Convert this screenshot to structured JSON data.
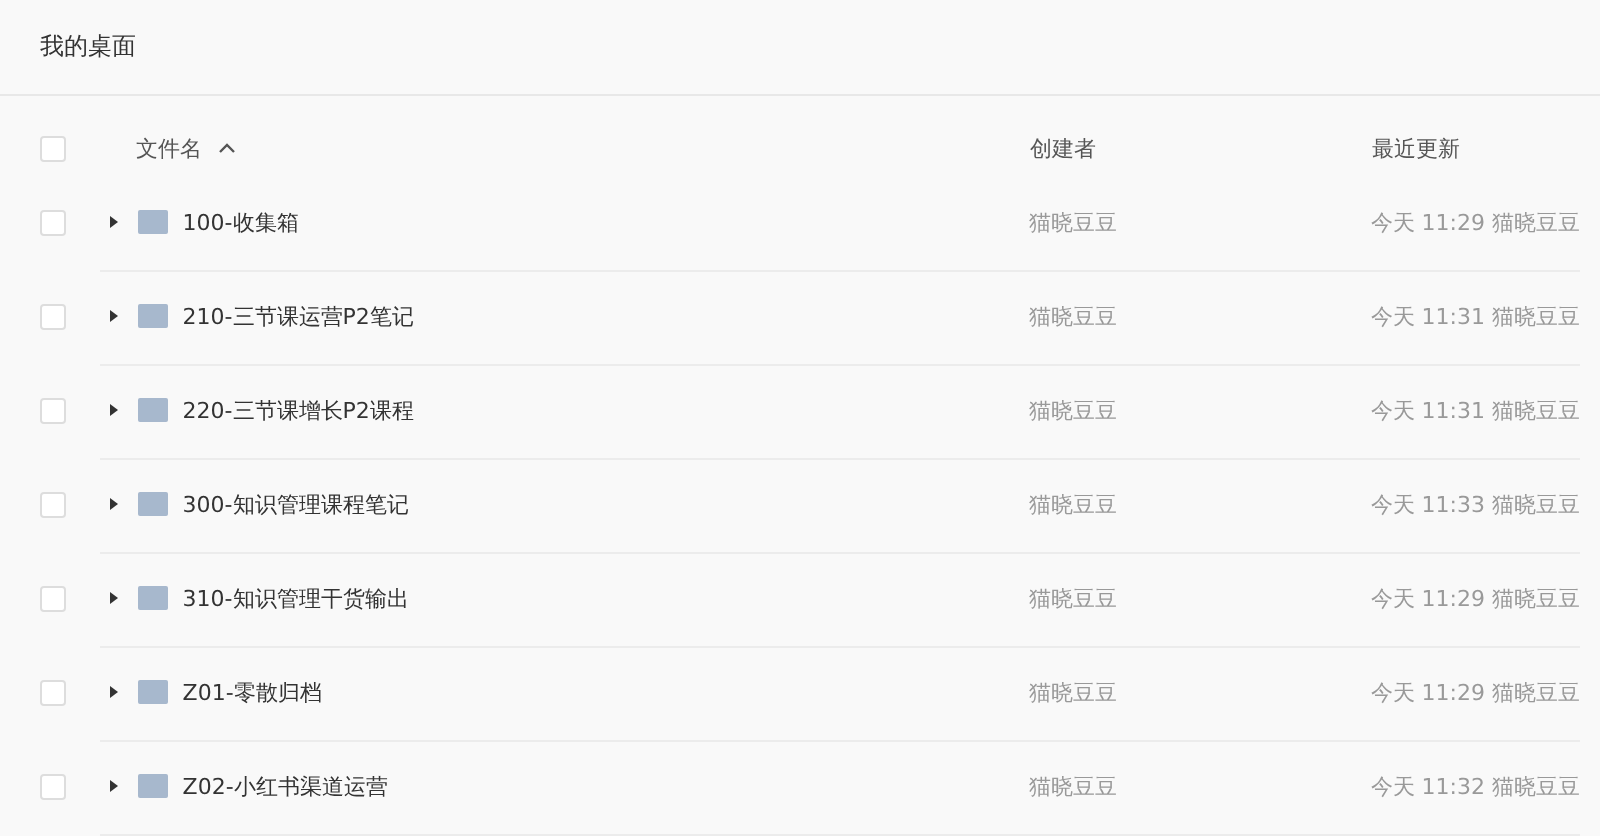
{
  "title": "我的桌面",
  "columns": [
    {
      "label": "文件名",
      "sorted_ascending": true
    },
    {
      "label": "创建者"
    },
    {
      "label": "最近更新"
    }
  ],
  "select_all": {
    "checked": false
  },
  "rows": [
    {
      "checked": false,
      "expanded": false,
      "name": "100-收集箱",
      "creator": "猫晓豆豆",
      "updated": "今天 11:29 猫晓豆豆"
    },
    {
      "checked": false,
      "expanded": false,
      "name": "210-三节课运营P2笔记",
      "creator": "猫晓豆豆",
      "updated": "今天 11:31 猫晓豆豆"
    },
    {
      "checked": false,
      "expanded": false,
      "name": "220-三节课增长P2课程",
      "creator": "猫晓豆豆",
      "updated": "今天 11:31 猫晓豆豆"
    },
    {
      "checked": false,
      "expanded": false,
      "name": "300-知识管理课程笔记",
      "creator": "猫晓豆豆",
      "updated": "今天 11:33 猫晓豆豆"
    },
    {
      "checked": false,
      "expanded": false,
      "name": "310-知识管理干货输出",
      "creator": "猫晓豆豆",
      "updated": "今天 11:29 猫晓豆豆"
    },
    {
      "checked": false,
      "expanded": false,
      "name": "Z01-零散归档",
      "creator": "猫晓豆豆",
      "updated": "今天 11:29 猫晓豆豆"
    },
    {
      "checked": false,
      "expanded": false,
      "name": "Z02-小红书渠道运营",
      "creator": "猫晓豆豆",
      "updated": "今天 11:32 猫晓豆豆"
    }
  ]
}
